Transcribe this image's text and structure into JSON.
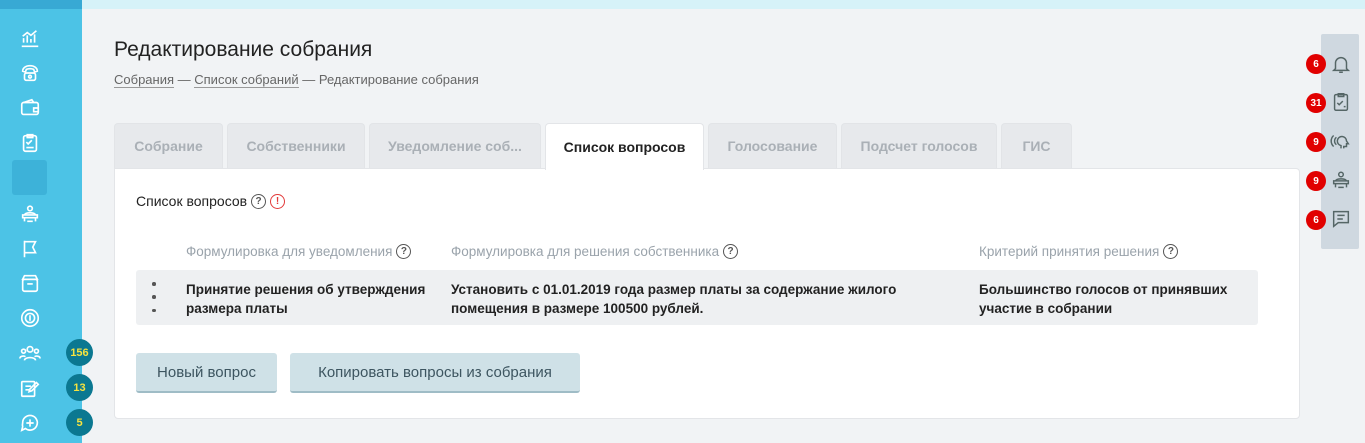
{
  "page": {
    "title": "Редактирование собрания",
    "breadcrumb": {
      "link1": "Собрания",
      "sep1": " — ",
      "link2": "Список собраний",
      "sep2": " — ",
      "current": "Редактирование собрания"
    }
  },
  "tabs": [
    {
      "label": "Собрание",
      "active": false
    },
    {
      "label": "Собственники",
      "active": false
    },
    {
      "label": "Уведомление соб...",
      "active": false
    },
    {
      "label": "Список вопросов",
      "active": true
    },
    {
      "label": "Голосование",
      "active": false
    },
    {
      "label": "Подсчет голосов",
      "active": false
    },
    {
      "label": "ГИС",
      "active": false
    }
  ],
  "questions": {
    "section_title": "Список вопросов",
    "help_glyph": "?",
    "warning_glyph": "!",
    "columns": [
      "Формулировка для уведомления",
      "Формулировка для решения собственника",
      "Критерий принятия решения"
    ],
    "rows": [
      {
        "notice_line1": "Принятие решения об утверждения",
        "notice_line2": "размера платы",
        "decision_line1": "Установить с 01.01.2019 года размер платы за содержание жилого",
        "decision_line2": "помещения в размере 100500 рублей.",
        "criterion_line1": "Большинство голосов от принявших",
        "criterion_line2": "участие в собрании"
      }
    ],
    "buttons": {
      "new_question": "Новый вопрос",
      "copy_questions": "Копировать вопросы из собрания"
    }
  },
  "sidebar": {
    "items": [
      {
        "icon": "chart-icon"
      },
      {
        "icon": "phone-icon"
      },
      {
        "icon": "wallet-icon"
      },
      {
        "icon": "clipboard-icon"
      },
      {
        "icon": "active-item"
      },
      {
        "icon": "support-icon"
      },
      {
        "icon": "flag-icon"
      },
      {
        "icon": "archive-icon"
      },
      {
        "icon": "coin-icon"
      },
      {
        "icon": "users-icon",
        "badge": "156"
      },
      {
        "icon": "edit-icon",
        "badge": "13"
      },
      {
        "icon": "chat-add-icon",
        "badge": "5"
      }
    ]
  },
  "notifications": {
    "bell": "6",
    "tasks": "31",
    "calls": "9",
    "reception": "9",
    "messages": "6"
  },
  "colors": {
    "sidebar": "#4cc3e6",
    "badge_bg": "#0b7891",
    "badge_text": "#f6e33f",
    "alert_badge": "#e10000",
    "button_bg": "#cfe1e7"
  }
}
